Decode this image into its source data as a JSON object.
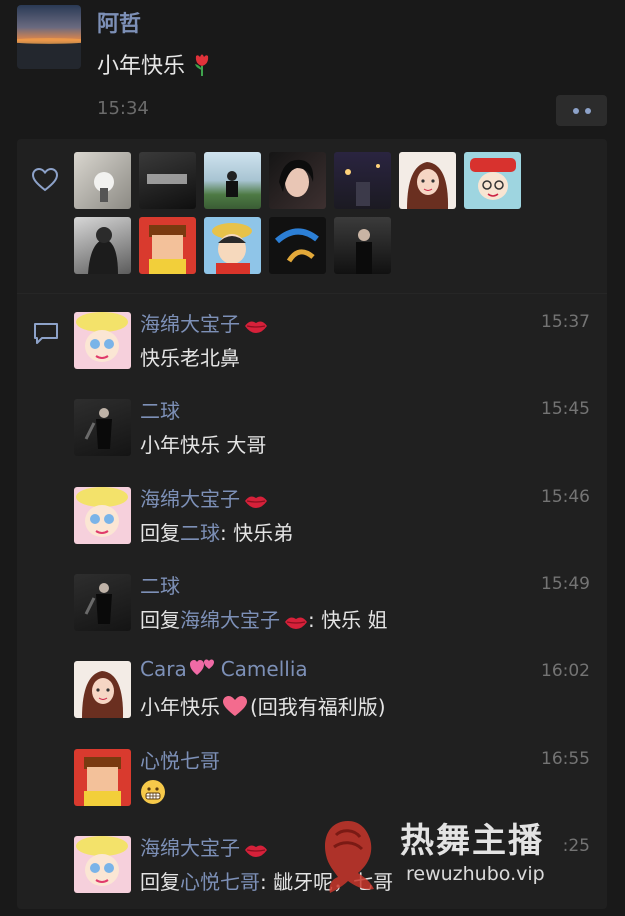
{
  "post": {
    "author": "阿哲",
    "text": "小年快乐",
    "time": "15:34",
    "more_icon": "more-dots-icon"
  },
  "likes": {
    "icon": "heart-outline-icon",
    "avatars_row1": [
      "avatar-1",
      "avatar-2",
      "avatar-3",
      "avatar-4",
      "avatar-5",
      "avatar-6",
      "avatar-7"
    ],
    "avatars_row2": [
      "avatar-8",
      "avatar-9",
      "avatar-10",
      "avatar-11",
      "avatar-12"
    ]
  },
  "comments": [
    {
      "name": "海绵大宝子",
      "time": "15:37",
      "text": "快乐老北鼻",
      "reply_prefix": "",
      "reply_to": "",
      "lips": true
    },
    {
      "name": "二球",
      "time": "15:45",
      "text": "小年快乐 大哥",
      "reply_prefix": "",
      "reply_to": "",
      "lips": false
    },
    {
      "name": "海绵大宝子",
      "time": "15:46",
      "text": "快乐弟",
      "reply_prefix": "回复",
      "reply_to": "二球",
      "lips": true
    },
    {
      "name": "二球",
      "time": "15:49",
      "text": "快乐 姐",
      "reply_prefix": "回复",
      "reply_to": "海绵大宝子",
      "lips": false
    },
    {
      "name": "Cara",
      "name2": "Camellia",
      "time": "16:02",
      "text": "小年快乐",
      "text2": "(回我有福利版)",
      "lips": false
    },
    {
      "name": "心悦七哥",
      "time": "16:55",
      "text": "",
      "lips": false
    },
    {
      "name": "海绵大宝子",
      "time": ":25",
      "text": "龇牙呢，七哥",
      "reply_prefix": "回复",
      "reply_to": "心悦七哥",
      "lips": true
    }
  ],
  "watermark": {
    "title": "热舞主播",
    "url": "rewuzhubo.vip"
  },
  "colors": {
    "background": "#191919",
    "link": "#7d90b7"
  }
}
